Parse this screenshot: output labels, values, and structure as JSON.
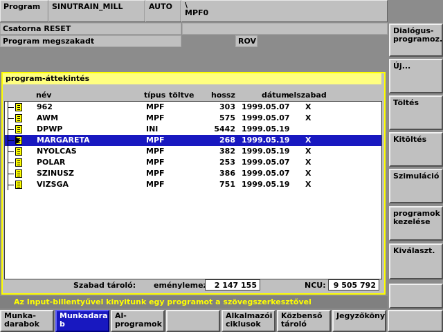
{
  "header": {
    "program_label": "Program",
    "machine_name": "SINUTRAIN_MILL",
    "mode": "AUTO",
    "path_line1": "\\",
    "path_line2": "MPF0",
    "channel_state": "Csatorna RESET",
    "program_state": "Program megszakadt",
    "rov": "ROV"
  },
  "panel": {
    "title": "program-áttekintés",
    "columns": {
      "name": "név",
      "type": "típus",
      "loaded": "töltve",
      "length": "hossz",
      "date": "dátum",
      "enabled": "elszabad"
    },
    "programs": [
      {
        "name": "962",
        "type": "MPF",
        "loaded": "",
        "length": "303",
        "date": "1999.05.07",
        "enabled": "X"
      },
      {
        "name": "AWM",
        "type": "MPF",
        "loaded": "",
        "length": "575",
        "date": "1999.05.07",
        "enabled": "X"
      },
      {
        "name": "DPWP",
        "type": "INI",
        "loaded": "",
        "length": "5442",
        "date": "1999.05.19",
        "enabled": ""
      },
      {
        "name": "MARGARETA",
        "type": "MPF",
        "loaded": "",
        "length": "268",
        "date": "1999.05.19",
        "enabled": "X"
      },
      {
        "name": "NYOLCAS",
        "type": "MPF",
        "loaded": "",
        "length": "382",
        "date": "1999.05.19",
        "enabled": "X"
      },
      {
        "name": "POLAR",
        "type": "MPF",
        "loaded": "",
        "length": "253",
        "date": "1999.05.07",
        "enabled": "X"
      },
      {
        "name": "SZINUSZ",
        "type": "MPF",
        "loaded": "",
        "length": "386",
        "date": "1999.05.07",
        "enabled": "X"
      },
      {
        "name": "VIZSGA",
        "type": "MPF",
        "loaded": "",
        "length": "751",
        "date": "1999.05.19",
        "enabled": "X"
      }
    ],
    "selected_index": 3,
    "status": {
      "free_memory_label": "Szabad tároló:",
      "request_label": "eménylemez:",
      "request_value": "2 147 155",
      "ncu_label": "NCU:",
      "ncu_value": "9 505 792"
    }
  },
  "message": "Az Input-billentyűvel kinyitunk egy programot a szövegszerkesztővel",
  "vertical_softkeys": [
    "Dialógus-\nprogramoz.",
    "Új...",
    "Töltés",
    "Kitöltés",
    "Szimuláció",
    "programok\nkezelése",
    "Kiválaszt.",
    ""
  ],
  "horizontal_softkeys": [
    {
      "label": "Munka-\ndarabok",
      "active": false
    },
    {
      "label": "Munkadara\nb",
      "active": true
    },
    {
      "label": "Al-\nprogramok",
      "active": false
    },
    {
      "label": "",
      "active": false
    },
    {
      "label": "Alkalmazói\nciklusok",
      "active": false
    },
    {
      "label": "Közbenső\ntároló",
      "active": false
    },
    {
      "label": "Jegyzőköny",
      "active": false
    },
    {
      "label": "",
      "active": false
    }
  ],
  "colors": {
    "selection": "#1818c0",
    "panel_border": "#ffff00",
    "message_text": "#ffff00"
  }
}
